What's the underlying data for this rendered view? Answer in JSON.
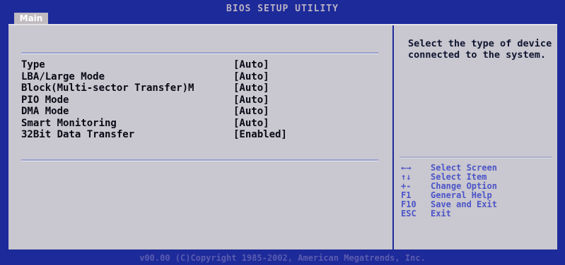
{
  "header": {
    "tab_label": "Main",
    "title": "BIOS SETUP UTILITY"
  },
  "settings": [
    {
      "label": "Type",
      "value": "[Auto]"
    },
    {
      "label": "LBA/Large Mode",
      "value": "[Auto]"
    },
    {
      "label": "Block(Multi-sector Transfer)M",
      "value": "[Auto]"
    },
    {
      "label": "PIO Mode",
      "value": "[Auto]"
    },
    {
      "label": "DMA Mode",
      "value": "[Auto]"
    },
    {
      "label": "Smart Monitoring",
      "value": "[Auto]"
    },
    {
      "label": "32Bit Data Transfer",
      "value": "[Enabled]"
    }
  ],
  "help": {
    "text": "Select the type of device connected to the system."
  },
  "keys": [
    {
      "key": "←→",
      "desc": "Select Screen"
    },
    {
      "key": "↑↓",
      "desc": "Select Item"
    },
    {
      "key": "+-",
      "desc": "Change Option"
    },
    {
      "key": "F1",
      "desc": "General Help"
    },
    {
      "key": "F10",
      "desc": "Save and Exit"
    },
    {
      "key": "ESC",
      "desc": "Exit"
    }
  ],
  "footer": {
    "text": "v00.00 (C)Copyright 1985-2002, American Megatrends, Inc."
  },
  "colors": {
    "background": "#1d2a9a",
    "panel": "#c9c7cf",
    "text": "#070915",
    "key_text": "#4b55c8"
  }
}
